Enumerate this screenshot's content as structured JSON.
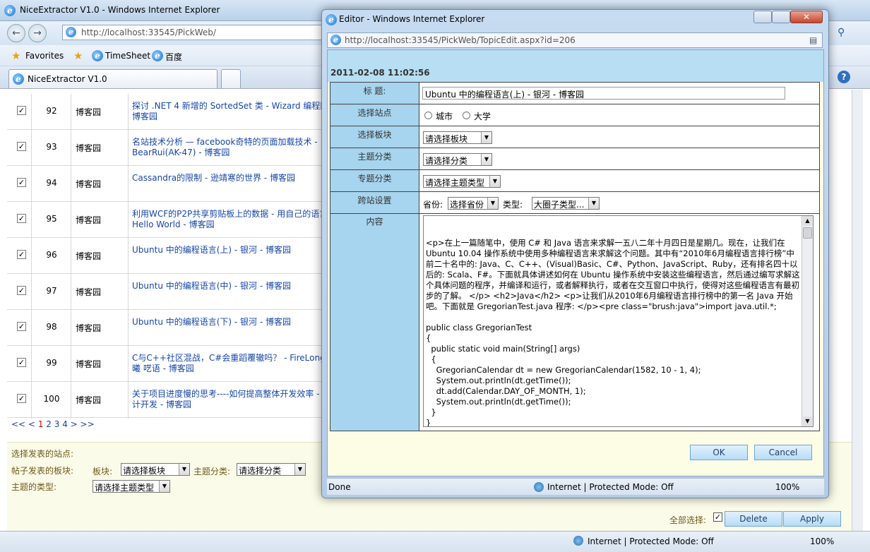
{
  "main_window": {
    "title": "NiceExtractor V1.0 - Windows Internet Explorer",
    "url": "http://localhost:33545/PickWeb/",
    "favorites_label": "Favorites",
    "fav_links": [
      "TimeSheet",
      "百度"
    ],
    "tab_label": "NiceExtractor V1.0",
    "rows": [
      {
        "num": "92",
        "source": "博客园",
        "title": "探讨 .NET 4 新增的 SortedSet 类 - Wizard 编程网 - 博客园",
        "checked": true
      },
      {
        "num": "93",
        "source": "博客园",
        "title": "名站技术分析 — facebook奇特的页面加载技术 - BearRui(AK-47) - 博客园",
        "checked": true
      },
      {
        "num": "94",
        "source": "博客园",
        "title": "Cassandra的限制 - 逊靖寒的世界 - 博客园",
        "checked": true
      },
      {
        "num": "95",
        "source": "博客园",
        "title": "利用WCF的P2P共享剪贴板上的数据 - 用自己的语言个Hello World - 博客园",
        "checked": true
      },
      {
        "num": "96",
        "source": "博客园",
        "title": "Ubuntu 中的编程语言(上) - 银河 - 博客园",
        "checked": true
      },
      {
        "num": "97",
        "source": "博客园",
        "title": "Ubuntu 中的编程语言(中) - 银河 - 博客园",
        "checked": true
      },
      {
        "num": "98",
        "source": "博客园",
        "title": "Ubuntu 中的编程语言(下) - 银河 - 博客园",
        "checked": true
      },
      {
        "num": "99",
        "source": "博客园",
        "title": "C与C++社区混战，C#会重蹈覆辙吗？ - FireLong-曦 呓语 - 博客园",
        "checked": true
      },
      {
        "num": "100",
        "source": "博客园",
        "title": "关于项目进度慢的思考----如何提高整体开发效率 - 设计开发 - 博客园",
        "checked": true
      }
    ],
    "pager": {
      "prev": "<< <",
      "pages": [
        "1",
        "2",
        "3",
        "4"
      ],
      "current": "1",
      "next": "> >>"
    },
    "bottom": {
      "site_label": "选择发表的站点:",
      "board_label": "帖子发表的板块:",
      "board_sub_label": "板块:",
      "board_select": "请选择板块",
      "category_label": "主题分类:",
      "category_select": "请选择分类",
      "type_label": "主题的类型:",
      "type_select": "请选择主题类型",
      "select_all_label": "全部选择:",
      "delete_button": "Delete",
      "apply_button": "Apply"
    },
    "status": {
      "zone": "Internet | Protected Mode: Off",
      "zoom": "100%"
    }
  },
  "popup": {
    "title": "Editor - Windows Internet Explorer",
    "url": "http://localhost:33545/PickWeb/TopicEdit.aspx?id=206",
    "date": "2011-02-08 11:02:56",
    "labels": {
      "title": "标 题:",
      "site": "选择站点",
      "board": "选择板块",
      "category": "主题分类",
      "topic": "专题分类",
      "cross": "跨站设置",
      "content": "内容"
    },
    "title_value": "Ubuntu 中的编程语言(上) - 银河 - 博客园",
    "site_options": [
      "城市",
      "大学"
    ],
    "board_select": "请选择板块",
    "category_select": "请选择分类",
    "topic_select": "请选择主题类型",
    "cross": {
      "province_label": "省份:",
      "province_select": "选择省份",
      "type_label": "类型:",
      "type_select": "大圈子类型..."
    },
    "content_text": "<p>在上一篇随笔中，使用 C# 和 Java 语言来求解一五八二年十月四日是星期几。现在，让我们在 Ubuntu 10.04 操作系统中使用多种编程语言来求解这个问题。其中有“2010年6月编程语言排行榜”中前二十名中的: Java、C、C++、(Visual)Basic、C#、Python、JavaScript、Ruby，还有排名四十以后的: Scala、F#。下面就具体讲述如何在 Ubuntu 操作系统中安装这些编程语言，然后通过编写求解这个具体问题的程序，并编译和运行，或者解释执行，或者在交互窗口中执行，使得对这些编程语言有最初步的了解。 </p> <h2>Java</h2> <p>让我们从2010年6月编程语言排行榜中的第一名 Java 开始吧。下面就是 GregorianTest.java 程序: </p><pre class=\"brush:java\">import java.util.*;\n\npublic class GregorianTest\n{\n  public static void main(String[] args)\n  {\n    GregorianCalendar dt = new GregorianCalendar(1582, 10 - 1, 4);\n    System.out.println(dt.getTime());\n    dt.add(Calendar.DAY_OF_MONTH, 1);\n    System.out.println(dt.getTime());\n  }\n}\n</pre>",
    "ok_button": "OK",
    "cancel_button": "Cancel",
    "status": {
      "done": "Done",
      "zone": "Internet | Protected Mode: Off",
      "zoom": "100%"
    }
  }
}
